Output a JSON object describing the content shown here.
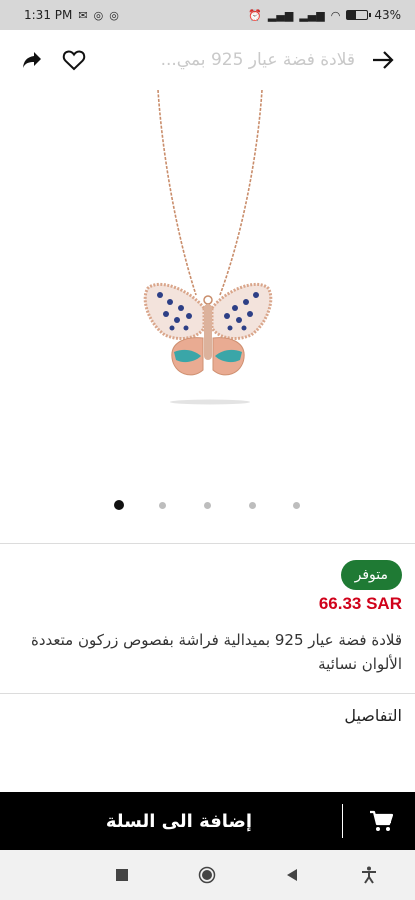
{
  "status_bar": {
    "time": "1:31 PM",
    "left_icons": [
      "mail-icon",
      "whatsapp-icon",
      "whatsapp-icon"
    ],
    "right_icons": [
      "alarm-icon",
      "signal-icon",
      "signal-icon",
      "wifi-icon"
    ],
    "battery_percent": "43"
  },
  "header": {
    "title": "قلادة فضة عيار 925 بمي...",
    "icons": [
      "back-arrow-icon",
      "heart-icon",
      "share-icon"
    ]
  },
  "gallery": {
    "image_subject": "rose gold butterfly pendant necklace",
    "page_count": 5,
    "active_index": 0
  },
  "product": {
    "availability": "متوفر",
    "price": "66.33 SAR",
    "name": "قلادة فضة عيار 925 بميدالية فراشة بفصوص زركون متعددة الألوان نسائية",
    "details_label": "التفاصيل"
  },
  "cart": {
    "add_label": "إضافة الى السلة"
  },
  "colors": {
    "status_bar_bg": "#d7d7d7",
    "price_red": "#d0021b",
    "badge_green": "#1f7a34",
    "cart_bar_bg": "#000000"
  }
}
